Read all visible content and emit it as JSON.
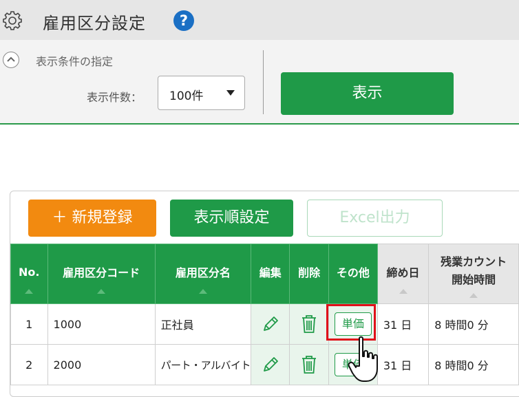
{
  "header": {
    "title": "雇用区分設定",
    "gear_icon": "gear-icon",
    "help_label": "?"
  },
  "condition": {
    "label": "表示条件の指定",
    "count_label": "表示件数：",
    "count_value": "100件",
    "show_label": "表示"
  },
  "toolbar": {
    "new_label": "＋ 新規登録",
    "order_label": "表示順設定",
    "excel_label": "Excel出力"
  },
  "table": {
    "headers": {
      "no": "No.",
      "code": "雇用区分コード",
      "name": "雇用区分名",
      "edit": "編集",
      "delete": "削除",
      "other": "その他",
      "closing": "締め日",
      "overtime_1": "残業カウント",
      "overtime_2": "開始時間"
    },
    "rows": [
      {
        "no": "1",
        "code": "1000",
        "name": "正社員",
        "other": "単価",
        "closing": "31 日",
        "overtime": "8 時間0 分"
      },
      {
        "no": "2",
        "code": "2000",
        "name": "パート・アルバイト",
        "other": "単価",
        "closing": "31 日",
        "overtime": "8 時間0 分"
      }
    ]
  },
  "colors": {
    "green": "#1f9a48",
    "orange": "#f28a10",
    "highlight": "#e0101a",
    "help_blue": "#1a6fc4"
  }
}
